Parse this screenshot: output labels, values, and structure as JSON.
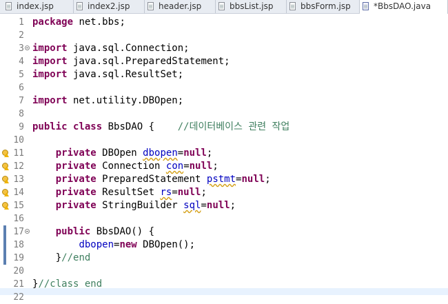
{
  "tabs": [
    {
      "label": "index.jsp",
      "active": false,
      "type": "jsp"
    },
    {
      "label": "index2.jsp",
      "active": false,
      "type": "jsp"
    },
    {
      "label": "header.jsp",
      "active": false,
      "type": "jsp"
    },
    {
      "label": "bbsList.jsp",
      "active": false,
      "type": "jsp"
    },
    {
      "label": "bbsForm.jsp",
      "active": false,
      "type": "jsp"
    },
    {
      "label": "*BbsDAO.java",
      "active": true,
      "type": "java"
    }
  ],
  "colors": {
    "keyword": "#7f0055",
    "field": "#0000c0",
    "comment": "#3f7f5f",
    "line_number": "#7a7a7a",
    "current_line_highlight": "#e8f2fe",
    "change_bar": "#5b7fb1"
  },
  "lines": [
    {
      "n": "1",
      "tokens": [
        [
          "kw",
          "package"
        ],
        [
          "t",
          " net.bbs;"
        ]
      ]
    },
    {
      "n": "2",
      "tokens": []
    },
    {
      "n": "3",
      "fold": true,
      "tokens": [
        [
          "kw",
          "import"
        ],
        [
          "t",
          " java.sql.Connection;"
        ]
      ]
    },
    {
      "n": "4",
      "tokens": [
        [
          "kw",
          "import"
        ],
        [
          "t",
          " java.sql.PreparedStatement;"
        ]
      ]
    },
    {
      "n": "5",
      "tokens": [
        [
          "kw",
          "import"
        ],
        [
          "t",
          " java.sql.ResultSet;"
        ]
      ]
    },
    {
      "n": "6",
      "tokens": []
    },
    {
      "n": "7",
      "tokens": [
        [
          "kw",
          "import"
        ],
        [
          "t",
          " net.utility.DBOpen;"
        ]
      ]
    },
    {
      "n": "8",
      "tokens": []
    },
    {
      "n": "9",
      "tokens": [
        [
          "kw",
          "public"
        ],
        [
          "t",
          " "
        ],
        [
          "kw",
          "class"
        ],
        [
          "t",
          " BbsDAO {    "
        ],
        [
          "cmt",
          "//데이터베이스 관련 작업"
        ]
      ]
    },
    {
      "n": "10",
      "tokens": []
    },
    {
      "n": "11",
      "marker": "warning-bulb",
      "tokens": [
        [
          "t",
          "    "
        ],
        [
          "kw",
          "private"
        ],
        [
          "t",
          " DBOpen "
        ],
        [
          "fldsq",
          "dbopen"
        ],
        [
          "t",
          "="
        ],
        [
          "kw",
          "null"
        ],
        [
          "t",
          ";"
        ]
      ]
    },
    {
      "n": "12",
      "marker": "warning-bulb",
      "tokens": [
        [
          "t",
          "    "
        ],
        [
          "kw",
          "private"
        ],
        [
          "t",
          " Connection "
        ],
        [
          "fldsq",
          "con"
        ],
        [
          "t",
          "="
        ],
        [
          "kw",
          "null"
        ],
        [
          "t",
          ";"
        ]
      ]
    },
    {
      "n": "13",
      "marker": "warning-bulb",
      "tokens": [
        [
          "t",
          "    "
        ],
        [
          "kw",
          "private"
        ],
        [
          "t",
          " PreparedStatement "
        ],
        [
          "fldsq",
          "pstmt"
        ],
        [
          "t",
          "="
        ],
        [
          "kw",
          "null"
        ],
        [
          "t",
          ";"
        ]
      ]
    },
    {
      "n": "14",
      "marker": "warning-bulb",
      "tokens": [
        [
          "t",
          "    "
        ],
        [
          "kw",
          "private"
        ],
        [
          "t",
          " ResultSet "
        ],
        [
          "fldsq",
          "rs"
        ],
        [
          "t",
          "="
        ],
        [
          "kw",
          "null"
        ],
        [
          "t",
          ";"
        ]
      ]
    },
    {
      "n": "15",
      "marker": "warning-bulb",
      "tokens": [
        [
          "t",
          "    "
        ],
        [
          "kw",
          "private"
        ],
        [
          "t",
          " StringBuilder "
        ],
        [
          "fldsq",
          "sql"
        ],
        [
          "t",
          "="
        ],
        [
          "kw",
          "null"
        ],
        [
          "t",
          ";"
        ]
      ]
    },
    {
      "n": "16",
      "tokens": []
    },
    {
      "n": "17",
      "fold": true,
      "changed": true,
      "tokens": [
        [
          "t",
          "    "
        ],
        [
          "kw",
          "public"
        ],
        [
          "t",
          " BbsDAO() {"
        ]
      ]
    },
    {
      "n": "18",
      "changed": true,
      "tokens": [
        [
          "t",
          "        "
        ],
        [
          "fld",
          "dbopen"
        ],
        [
          "t",
          "="
        ],
        [
          "kw",
          "new"
        ],
        [
          "t",
          " DBOpen();"
        ]
      ]
    },
    {
      "n": "19",
      "changed": true,
      "tokens": [
        [
          "t",
          "    }"
        ],
        [
          "cmt",
          "//end"
        ]
      ]
    },
    {
      "n": "20",
      "tokens": []
    },
    {
      "n": "21",
      "tokens": [
        [
          "t",
          "}"
        ],
        [
          "cmt",
          "//class end"
        ]
      ]
    },
    {
      "n": "22",
      "tokens": []
    }
  ]
}
